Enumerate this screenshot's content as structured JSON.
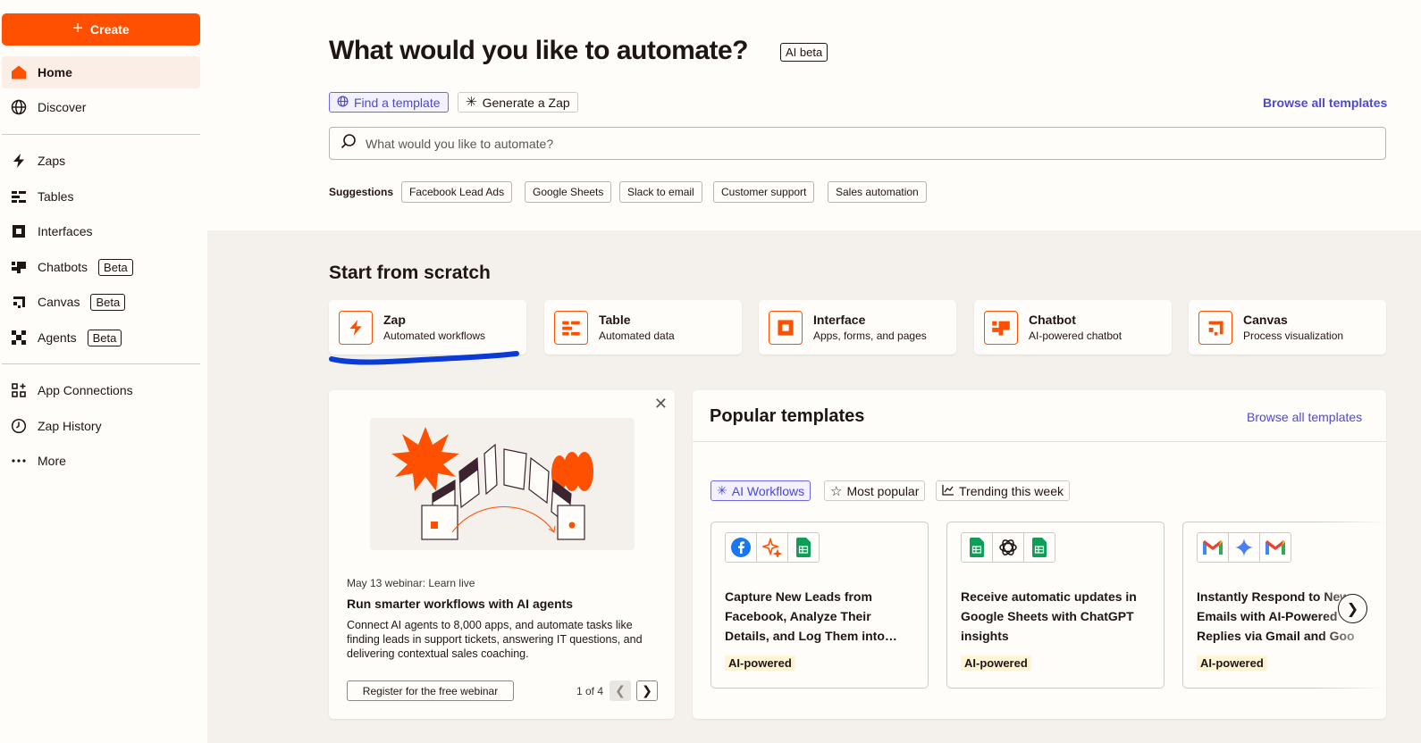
{
  "sidebar": {
    "create_label": "Create",
    "items": [
      {
        "label": "Home",
        "icon": "home-icon"
      },
      {
        "label": "Discover",
        "icon": "globe-icon"
      },
      {
        "label": "Zaps",
        "icon": "bolt-icon"
      },
      {
        "label": "Tables",
        "icon": "tables-icon"
      },
      {
        "label": "Interfaces",
        "icon": "interfaces-icon"
      },
      {
        "label": "Chatbots",
        "icon": "chatbot-icon",
        "badge": "Beta"
      },
      {
        "label": "Canvas",
        "icon": "canvas-icon",
        "badge": "Beta"
      },
      {
        "label": "Agents",
        "icon": "agents-icon",
        "badge": "Beta"
      },
      {
        "label": "App Connections",
        "icon": "app-connections-icon"
      },
      {
        "label": "Zap History",
        "icon": "history-icon"
      },
      {
        "label": "More",
        "icon": "more-icon"
      }
    ]
  },
  "header": {
    "title": "What would you like to automate?",
    "badge": "AI beta",
    "tabs": [
      {
        "label": "Find a template"
      },
      {
        "label": "Generate a Zap"
      }
    ],
    "browse_all": "Browse all templates",
    "search_placeholder": "What would you like to automate?",
    "suggestions_label": "Suggestions",
    "suggestions": [
      "Facebook Lead Ads",
      "Google Sheets",
      "Slack to email",
      "Customer support",
      "Sales automation"
    ]
  },
  "scratch": {
    "title": "Start from scratch",
    "cards": [
      {
        "title": "Zap",
        "subtitle": "Automated workflows"
      },
      {
        "title": "Table",
        "subtitle": "Automated data"
      },
      {
        "title": "Interface",
        "subtitle": "Apps, forms, and pages"
      },
      {
        "title": "Chatbot",
        "subtitle": "AI-powered chatbot"
      },
      {
        "title": "Canvas",
        "subtitle": "Process visualization"
      }
    ]
  },
  "webinar": {
    "eyebrow": "May 13 webinar: Learn live",
    "title": "Run smarter workflows with AI agents",
    "body": "Connect AI agents to 8,000 apps, and automate tasks like finding leads in support tickets, answering IT questions, and delivering contextual sales coaching.",
    "button": "Register for the free webinar",
    "pager": "1 of 4"
  },
  "popular": {
    "title": "Popular templates",
    "browse_all": "Browse all templates",
    "tabs": [
      {
        "label": "AI Workflows"
      },
      {
        "label": "Most popular"
      },
      {
        "label": "Trending this week"
      }
    ],
    "templates": [
      {
        "title": "Capture New Leads from\nFacebook, Analyze Their\nDetails, and Log Them into…",
        "badge": "AI-powered",
        "apps": [
          "facebook-icon",
          "ai-sparkle-icon",
          "google-sheets-icon"
        ]
      },
      {
        "title": "Receive automatic updates in\nGoogle Sheets with ChatGPT\ninsights",
        "badge": "AI-powered",
        "apps": [
          "google-sheets-icon",
          "chatgpt-icon",
          "google-sheets-icon"
        ]
      },
      {
        "title": "Instantly Respond to New\nEmails with AI-Powered\nReplies via Gmail and Goo",
        "badge": "AI-powered",
        "apps": [
          "gmail-icon",
          "gemini-icon",
          "gmail-icon"
        ]
      }
    ]
  },
  "colors": {
    "accent": "#ff4f00",
    "link": "#4d49d3",
    "scribble": "#0a3bd6"
  }
}
